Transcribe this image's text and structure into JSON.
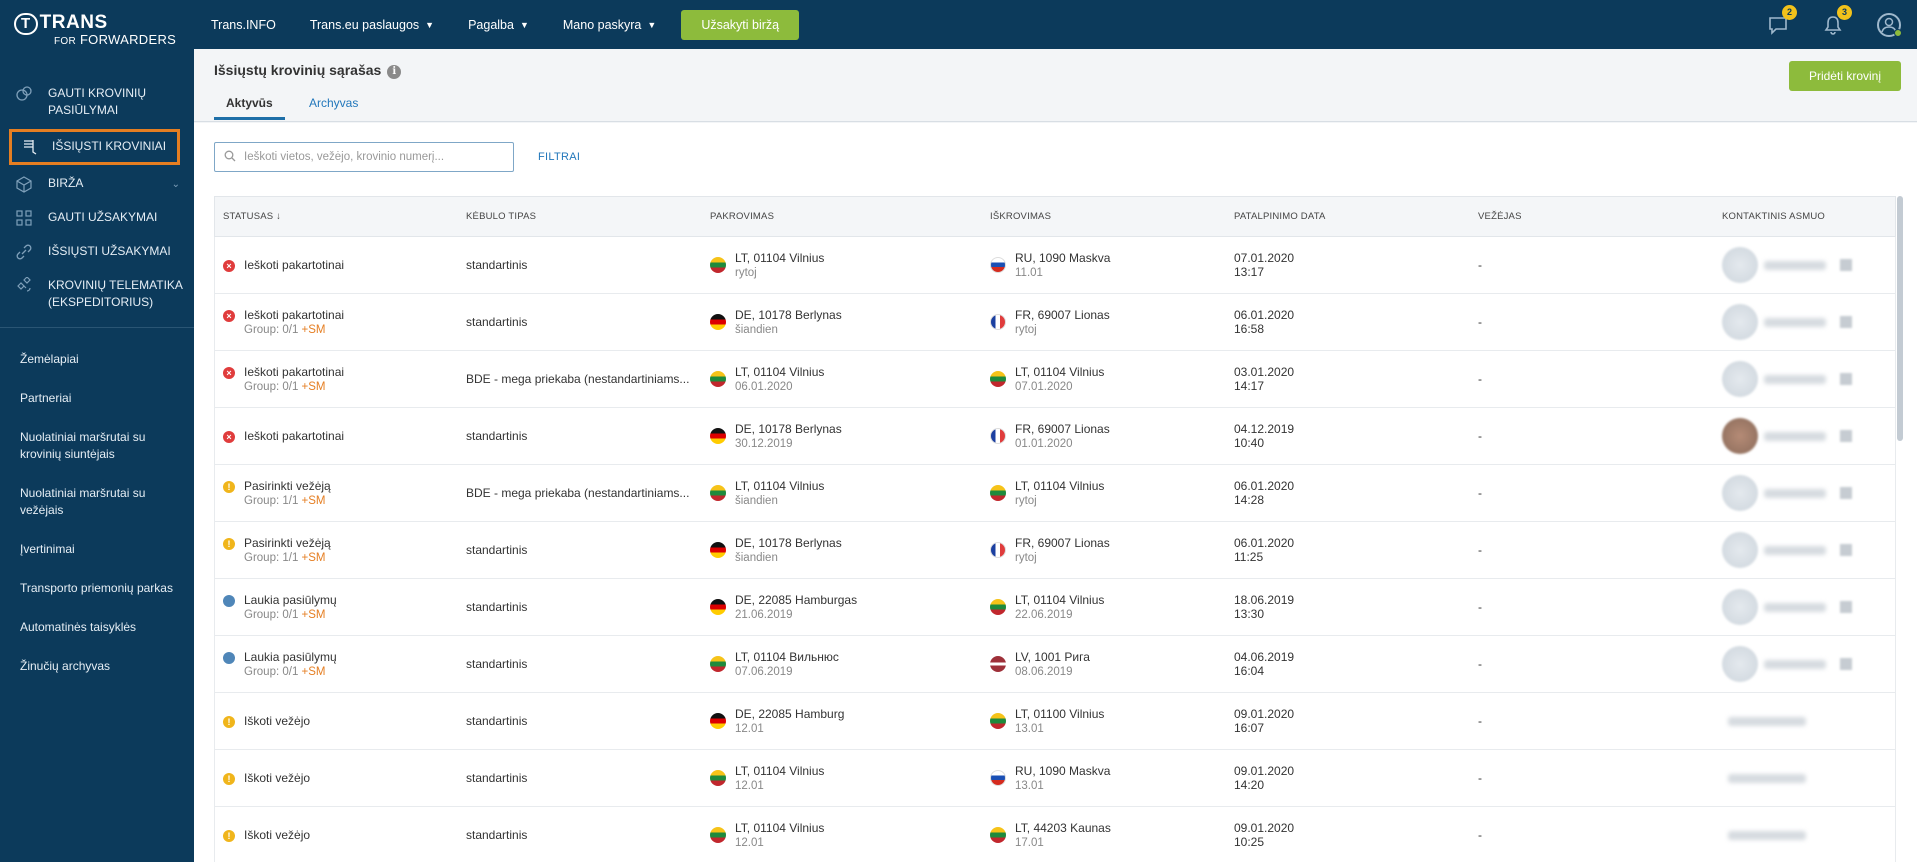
{
  "logo": {
    "line1": "TRANS",
    "mark": "T",
    "line2a": "FOR",
    "line2b": "FORWARDERS"
  },
  "sidebar": {
    "main": [
      {
        "label": "GAUTI KROVINIŲ PASIŪLYMAI",
        "icon": "offers-icon"
      },
      {
        "label": "IŠSIŲSTI KROVINIAI",
        "icon": "sent-cargo-icon",
        "active": true
      },
      {
        "label": "BIRŽA",
        "icon": "box-icon"
      },
      {
        "label": "GAUTI UŽSAKYMAI",
        "icon": "grid-icon"
      },
      {
        "label": "IŠSIŲSTI UŽSAKYMAI",
        "icon": "link-icon"
      },
      {
        "label": "KROVINIŲ TELEMATIKA (EKSPEDITORIUS)",
        "icon": "satellite-icon"
      }
    ],
    "sub": [
      "Žemėlapiai",
      "Partneriai",
      "Nuolatiniai maršrutai su krovinių siuntėjais",
      "Nuolatiniai maršrutai su vežėjais",
      "Įvertinimai",
      "Transporto priemonių parkas",
      "Automatinės taisyklės",
      "Žinučių archyvas"
    ]
  },
  "topbar": {
    "links": [
      "Trans.INFO",
      "Trans.eu paslaugos",
      "Pagalba",
      "Mano paskyra"
    ],
    "order_button": "Užsakyti biržą",
    "messages_badge": "2",
    "notifications_badge": "3"
  },
  "page": {
    "title": "Išsiųstų krovinių sąrašas",
    "tabs": [
      "Aktyvūs",
      "Archyvas"
    ],
    "add_button": "Pridėti krovinį",
    "search_placeholder": "Ieškoti vietos, vežėjo, krovinio numerį...",
    "filters": "FILTRAI"
  },
  "table": {
    "headers": [
      "STATUSAS ↓",
      "KĖBULO TIPAS",
      "PAKROVIMAS",
      "IŠKROVIMAS",
      "PATALPINIMO DATA",
      "VEŽĖJAS",
      "KONTAKTINIS ASMUO"
    ],
    "rows": [
      {
        "status": "Ieškoti pakartotinai",
        "status_color": "red",
        "group": "",
        "body": "standartinis",
        "load": "LT, 01104 Vilnius",
        "load_flag": "lt",
        "load_date": "rytoj",
        "unload": "RU, 1090 Maskva",
        "unload_flag": "ru",
        "unload_date": "11.01",
        "date": "07.01.2020",
        "time": "13:17",
        "carrier": "-"
      },
      {
        "status": "Ieškoti pakartotinai",
        "status_color": "red",
        "group": "Group: 0/1",
        "body": "standartinis",
        "load": "DE, 10178 Berlynas",
        "load_flag": "de",
        "load_date": "šiandien",
        "unload": "FR, 69007 Lionas",
        "unload_flag": "fr",
        "unload_date": "rytoj",
        "date": "06.01.2020",
        "time": "16:58",
        "carrier": "-"
      },
      {
        "status": "Ieškoti pakartotinai",
        "status_color": "red",
        "group": "Group: 0/1",
        "body": "BDE - mega priekaba (nestandartiniams...",
        "load": "LT, 01104 Vilnius",
        "load_flag": "lt",
        "load_date": "06.01.2020",
        "unload": "LT, 01104 Vilnius",
        "unload_flag": "lt",
        "unload_date": "07.01.2020",
        "date": "03.01.2020",
        "time": "14:17",
        "carrier": "-"
      },
      {
        "status": "Ieškoti pakartotinai",
        "status_color": "red",
        "group": "",
        "body": "standartinis",
        "load": "DE, 10178 Berlynas",
        "load_flag": "de",
        "load_date": "30.12.2019",
        "unload": "FR, 69007 Lionas",
        "unload_flag": "fr",
        "unload_date": "01.01.2020",
        "date": "04.12.2019",
        "time": "10:40",
        "carrier": "-",
        "photo": true
      },
      {
        "status": "Pasirinkti vežėją",
        "status_color": "yellow",
        "group": "Group: 1/1",
        "body": "BDE - mega priekaba (nestandartiniams...",
        "load": "LT, 01104 Vilnius",
        "load_flag": "lt",
        "load_date": "šiandien",
        "unload": "LT, 01104 Vilnius",
        "unload_flag": "lt",
        "unload_date": "rytoj",
        "date": "06.01.2020",
        "time": "14:28",
        "carrier": "-"
      },
      {
        "status": "Pasirinkti vežėją",
        "status_color": "yellow",
        "group": "Group: 1/1",
        "body": "standartinis",
        "load": "DE, 10178 Berlynas",
        "load_flag": "de",
        "load_date": "šiandien",
        "unload": "FR, 69007 Lionas",
        "unload_flag": "fr",
        "unload_date": "rytoj",
        "date": "06.01.2020",
        "time": "11:25",
        "carrier": "-"
      },
      {
        "status": "Laukia pasiūlymų",
        "status_color": "blue",
        "group": "Group: 0/1",
        "body": "standartinis",
        "load": "DE, 22085 Hamburgas",
        "load_flag": "de",
        "load_date": "21.06.2019",
        "unload": "LT, 01104 Vilnius",
        "unload_flag": "lt",
        "unload_date": "22.06.2019",
        "date": "18.06.2019",
        "time": "13:30",
        "carrier": "-"
      },
      {
        "status": "Laukia pasiūlymų",
        "status_color": "blue",
        "group": "Group: 0/1",
        "body": "standartinis",
        "load": "LT, 01104 Вильнюс",
        "load_flag": "lt",
        "load_date": "07.06.2019",
        "unload": "LV, 1001 Рига",
        "unload_flag": "lv",
        "unload_date": "08.06.2019",
        "date": "04.06.2019",
        "time": "16:04",
        "carrier": "-"
      },
      {
        "status": "Iškoti vežėjo",
        "status_color": "yellow",
        "group": "",
        "body": "standartinis",
        "load": "DE, 22085 Hamburg",
        "load_flag": "de",
        "load_date": "12.01",
        "unload": "LT, 01100 Vilnius",
        "unload_flag": "lt",
        "unload_date": "13.01",
        "date": "09.01.2020",
        "time": "16:07",
        "carrier": "-",
        "noav": true
      },
      {
        "status": "Iškoti vežėjo",
        "status_color": "yellow",
        "group": "",
        "body": "standartinis",
        "load": "LT, 01104 Vilnius",
        "load_flag": "lt",
        "load_date": "12.01",
        "unload": "RU, 1090 Maskva",
        "unload_flag": "ru",
        "unload_date": "13.01",
        "date": "09.01.2020",
        "time": "14:20",
        "carrier": "-",
        "noav": true
      },
      {
        "status": "Iškoti vežėjo",
        "status_color": "yellow",
        "group": "",
        "body": "standartinis",
        "load": "LT, 01104 Vilnius",
        "load_flag": "lt",
        "load_date": "12.01",
        "unload": "LT, 44203 Kaunas",
        "unload_flag": "lt",
        "unload_date": "17.01",
        "date": "09.01.2020",
        "time": "10:25",
        "carrier": "-",
        "noav": true
      }
    ],
    "sm_label": "+SM"
  }
}
